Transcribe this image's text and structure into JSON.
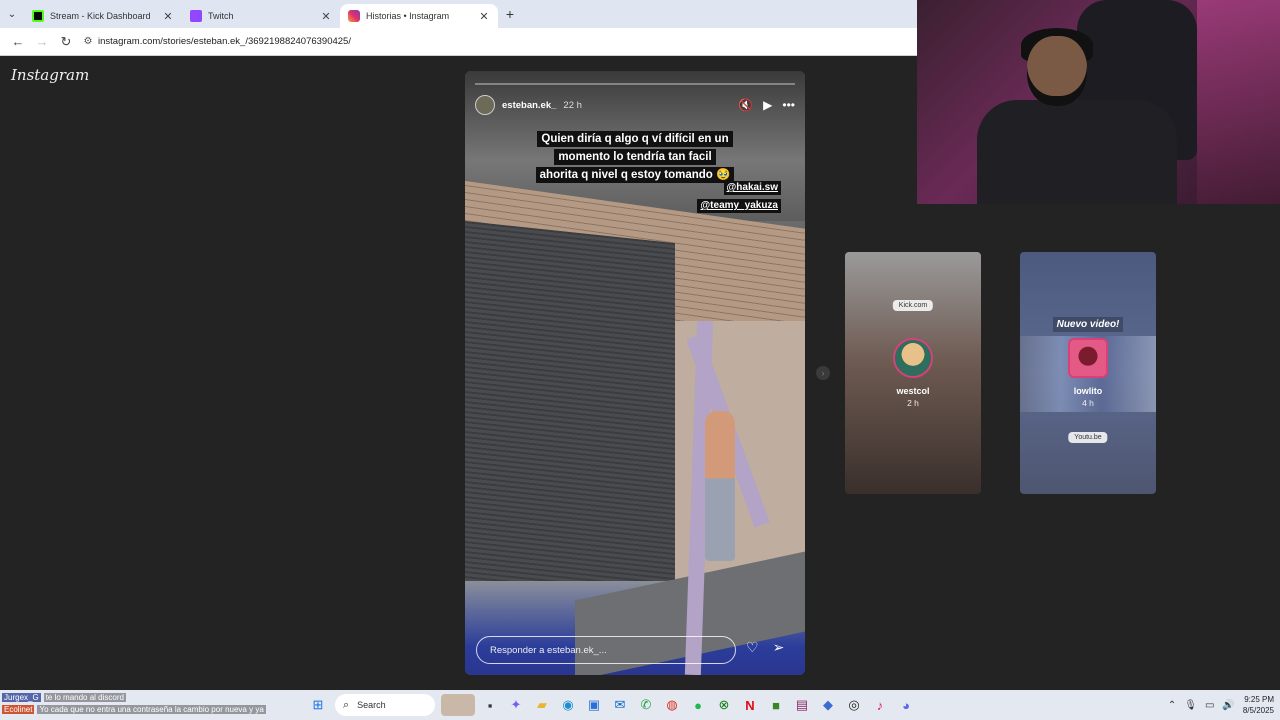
{
  "browser": {
    "tabs": [
      {
        "label": "Stream - Kick Dashboard",
        "color": "#53fc18"
      },
      {
        "label": "Twitch",
        "color": "#9146ff"
      },
      {
        "label": "Historias • Instagram",
        "color": "#e1306c",
        "active": true
      }
    ],
    "new_tab": "+",
    "url": "instagram.com/stories/esteban.ek_/3692198824076390425/"
  },
  "instagram": {
    "logo": "Instagram",
    "story": {
      "user": "esteban.ek_",
      "time": "22 h",
      "caption_lines": [
        "Quien diría q algo q ví difícil en un",
        "momento lo tendría tan facil",
        "ahorita q nivel q estoy tomando 🥹"
      ],
      "mentions": [
        "@hakai.sw",
        "@teamy_yakuza"
      ],
      "reply_placeholder": "Responder a esteban.ek_...",
      "progress": 0.0
    },
    "next_stories": [
      {
        "name": "westcol",
        "time": "2 h",
        "link": "Kick.com"
      },
      {
        "name": "lowlito",
        "time": "4 h",
        "heading": "Nuevo video!",
        "link": "Youtu.be"
      }
    ]
  },
  "chat": [
    {
      "user": "Jurgex_G",
      "message": "te lo mando al discord"
    },
    {
      "user": "Ecolinet",
      "message": "Yo cada que no entra una contraseña la cambio por nueva y ya"
    }
  ],
  "taskbar": {
    "search_label": "Search",
    "time": "9:25 PM",
    "date": "8/5/2025"
  }
}
